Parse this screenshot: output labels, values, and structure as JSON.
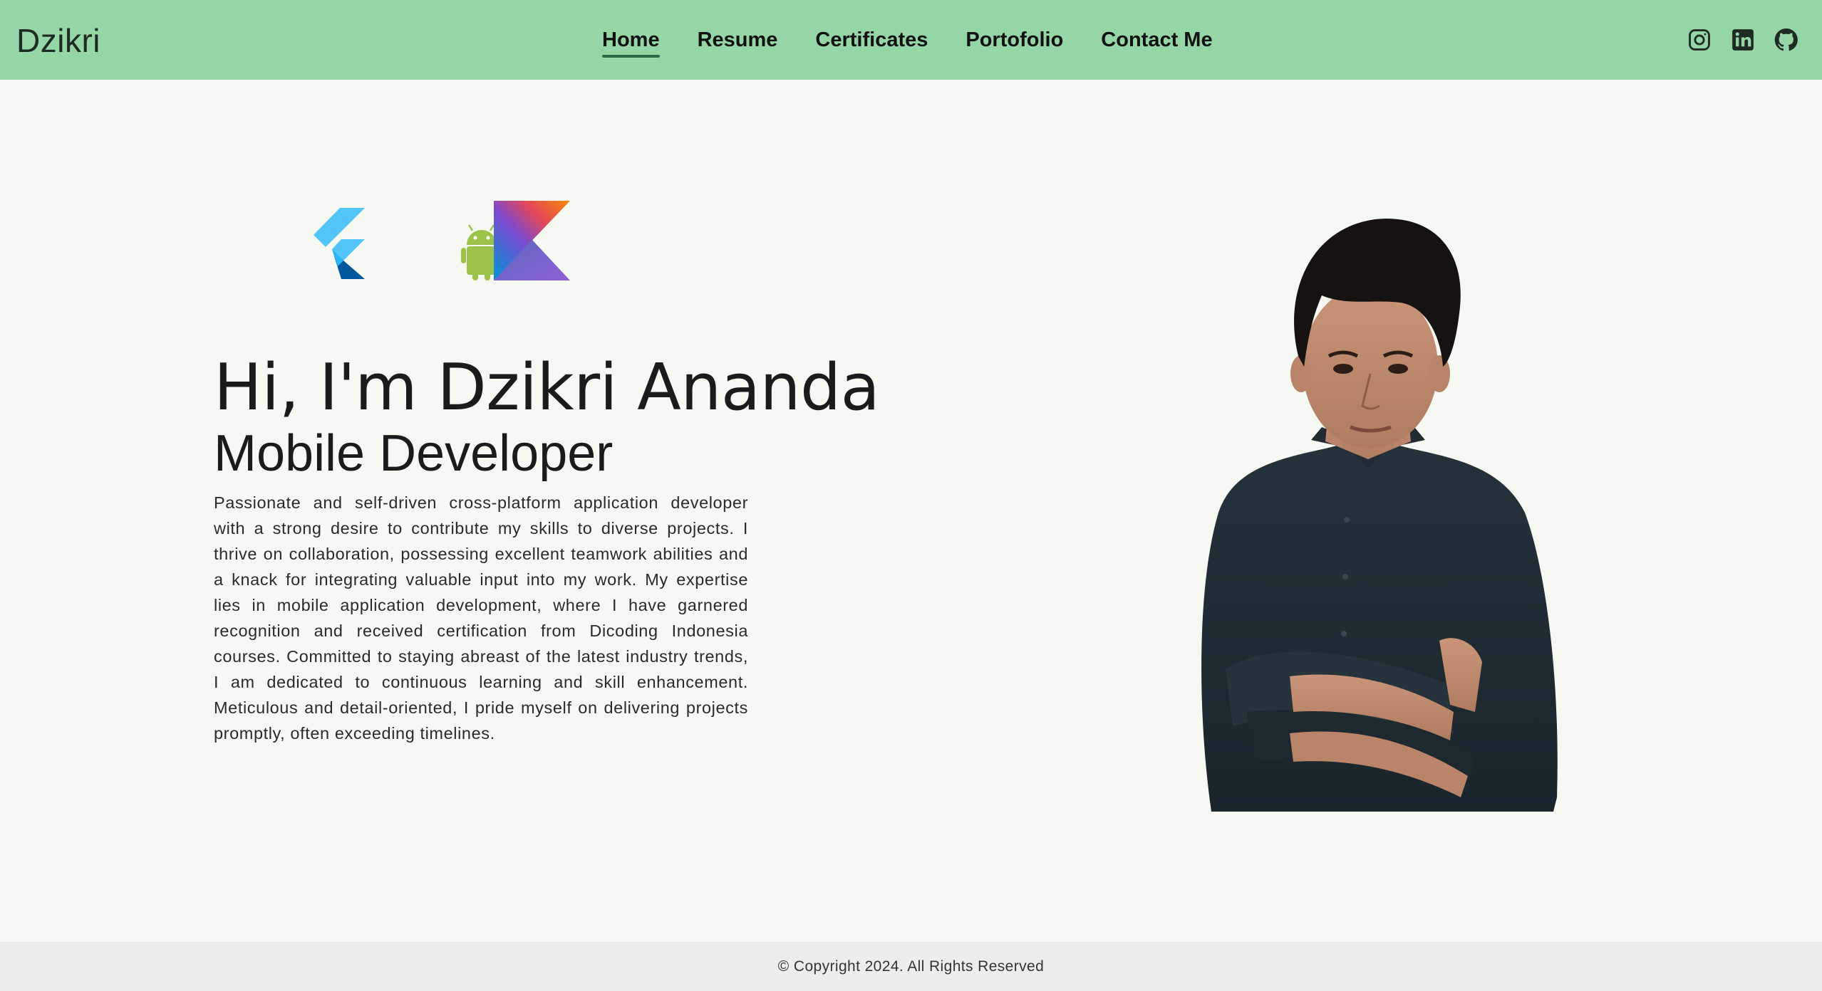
{
  "header": {
    "brand": "Dzikri",
    "nav": [
      {
        "label": "Home",
        "active": true
      },
      {
        "label": "Resume",
        "active": false
      },
      {
        "label": "Certificates",
        "active": false
      },
      {
        "label": "Portofolio",
        "active": false
      },
      {
        "label": "Contact Me",
        "active": false
      }
    ],
    "social": [
      {
        "icon": "instagram-icon"
      },
      {
        "icon": "linkedin-icon"
      },
      {
        "icon": "github-icon"
      }
    ]
  },
  "hero": {
    "tech_logos": [
      {
        "icon": "flutter-logo-icon"
      },
      {
        "icon": "kotlin-android-logo-icon"
      }
    ],
    "greeting": "Hi, I'm Dzikri Ananda",
    "role": "Mobile Developer",
    "bio": "Passionate and self-driven cross-platform application developer with a strong desire to contribute my skills to diverse projects. I thrive on collaboration, possessing excellent teamwork abilities and a knack for integrating valuable input into my work. My expertise lies in mobile application development, where I have garnered recognition and received certification from Dicoding Indonesia courses. Committed to staying abreast of the latest industry trends, I am dedicated to continuous learning and skill enhancement. Meticulous and detail-oriented, I pride myself on delivering projects promptly, often exceeding timelines."
  },
  "footer": {
    "copyright": "© Copyright 2024. All Rights Reserved"
  },
  "colors": {
    "navbar": "#95d6a7",
    "page_background": "#f5f9f2",
    "footer_background": "#eaf0e8",
    "active_underline": "#2d6b45"
  }
}
